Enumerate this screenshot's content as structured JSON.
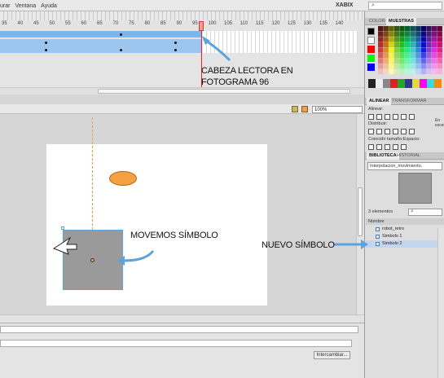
{
  "menu": {
    "items": [
      "urar",
      "Ventana",
      "Ayuda"
    ],
    "workspace": "XABIX"
  },
  "timeline": {
    "frame_numbers": [
      "35",
      "40",
      "45",
      "50",
      "55",
      "60",
      "65",
      "70",
      "75",
      "80",
      "85",
      "90",
      "95",
      "100",
      "105",
      "110",
      "115",
      "120",
      "125",
      "130",
      "135",
      "140"
    ],
    "current_frame": 96
  },
  "stage": {
    "zoom": "100%"
  },
  "properties": {
    "swap_label": "Intercambiar..."
  },
  "right_panel": {
    "color_tabs": [
      "COLOR",
      "MUESTRAS"
    ],
    "align_tabs": [
      "ALINEAR",
      "TRANSFORMAR"
    ],
    "align_label": "Alinear:",
    "distribute_label": "Distribuir:",
    "match_label": "Coincidir tamaño:Espacio:",
    "stage_label": "En escena",
    "library_tabs": [
      "BIBLIOTECA",
      "HISTORIAL"
    ],
    "library_file": "Interpolacion_movimiento.",
    "library_count": "3 elementos",
    "library_column": "Nombre",
    "library_items": [
      "robot_retro",
      "Simbolo 1",
      "Simbolo 2"
    ]
  },
  "annotations": {
    "playhead_1": "CABEZA LECTORA EN",
    "playhead_2": "FOTOGRAMA 96",
    "move": "MOVEMOS SÍMBOLO",
    "new_symbol": "NUEVO SÍMBOLO"
  },
  "colors": {
    "accent_arrow": "#5ba3dc",
    "layer_selected": "#7fb6ea",
    "ellipse": "#f5a142",
    "symbol": "#9a9a9a"
  }
}
